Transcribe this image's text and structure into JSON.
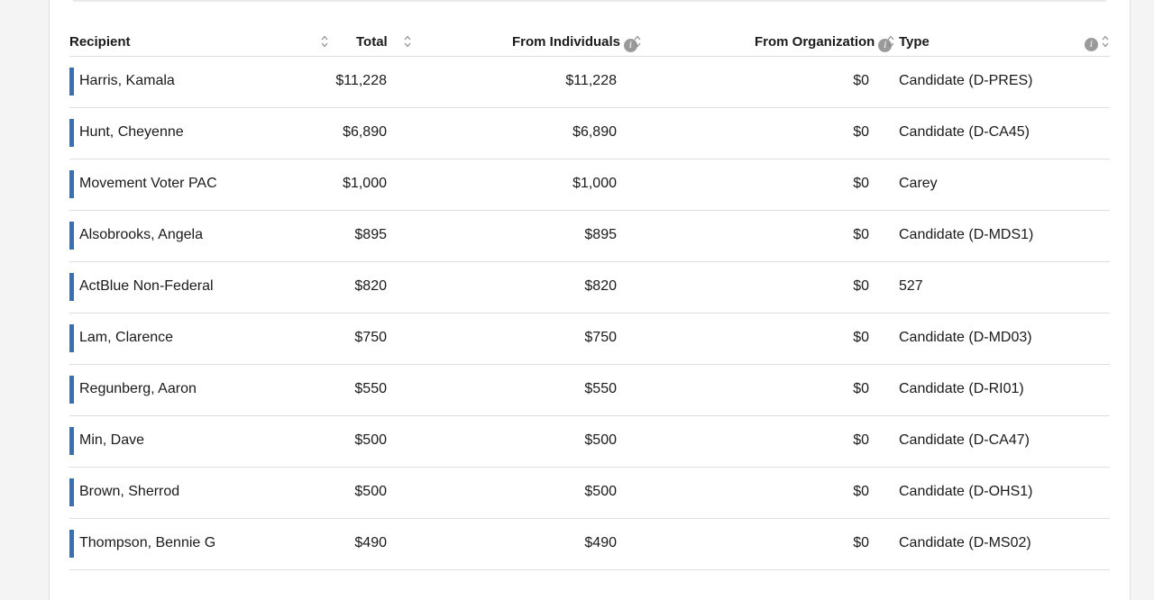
{
  "table": {
    "headers": {
      "recipient": "Recipient",
      "total": "Total",
      "from_individuals": "From Individuals",
      "from_organization": "From Organization",
      "type": "Type"
    },
    "rows": [
      {
        "recipient": "Harris, Kamala",
        "total": "$11,228",
        "from_individuals": "$11,228",
        "from_organization": "$0",
        "type": "Candidate (D-PRES)"
      },
      {
        "recipient": "Hunt, Cheyenne",
        "total": "$6,890",
        "from_individuals": "$6,890",
        "from_organization": "$0",
        "type": "Candidate (D-CA45)"
      },
      {
        "recipient": "Movement Voter PAC",
        "total": "$1,000",
        "from_individuals": "$1,000",
        "from_organization": "$0",
        "type": "Carey"
      },
      {
        "recipient": "Alsobrooks, Angela",
        "total": "$895",
        "from_individuals": "$895",
        "from_organization": "$0",
        "type": "Candidate (D-MDS1)"
      },
      {
        "recipient": "ActBlue Non-Federal",
        "total": "$820",
        "from_individuals": "$820",
        "from_organization": "$0",
        "type": "527"
      },
      {
        "recipient": "Lam, Clarence",
        "total": "$750",
        "from_individuals": "$750",
        "from_organization": "$0",
        "type": "Candidate (D-MD03)"
      },
      {
        "recipient": "Regunberg, Aaron",
        "total": "$550",
        "from_individuals": "$550",
        "from_organization": "$0",
        "type": "Candidate (D-RI01)"
      },
      {
        "recipient": "Min, Dave",
        "total": "$500",
        "from_individuals": "$500",
        "from_organization": "$0",
        "type": "Candidate (D-CA47)"
      },
      {
        "recipient": "Brown, Sherrod",
        "total": "$500",
        "from_individuals": "$500",
        "from_organization": "$0",
        "type": "Candidate (D-OHS1)"
      },
      {
        "recipient": "Thompson, Bennie G",
        "total": "$490",
        "from_individuals": "$490",
        "from_organization": "$0",
        "type": "Candidate (D-MS02)"
      }
    ]
  },
  "icons": {
    "sort": "sort-icon",
    "info": "info-icon"
  },
  "colors": {
    "row_accent": "#3a6fb0",
    "info_icon": "#9a9a9a"
  }
}
